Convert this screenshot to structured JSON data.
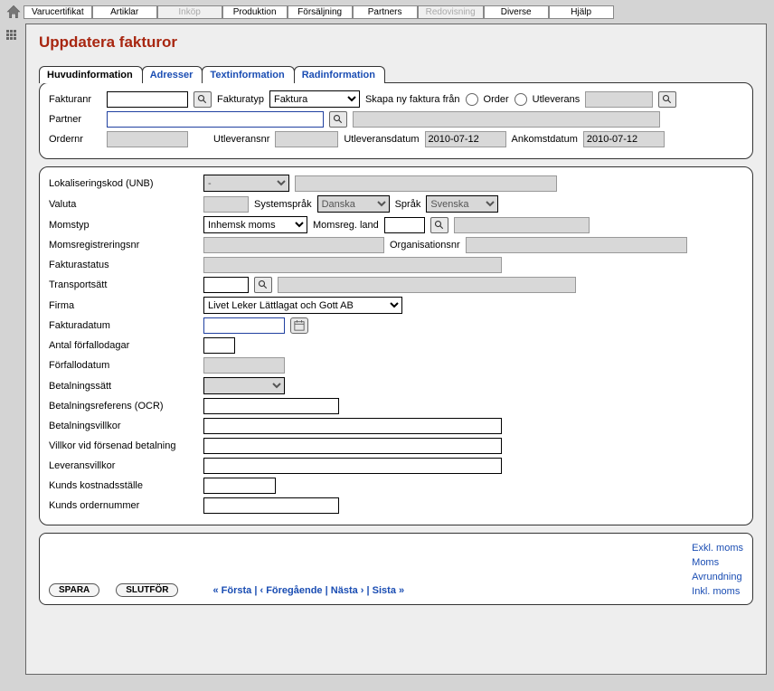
{
  "topTabs": [
    "Varucertifikat",
    "Artiklar",
    "Inköp",
    "Produktion",
    "Försäljning",
    "Partners",
    "Redovisning",
    "Diverse",
    "Hjälp"
  ],
  "topTabsDisabled": [
    2,
    6
  ],
  "pageTitle": "Uppdatera fakturor",
  "tabs": [
    "Huvudinformation",
    "Adresser",
    "Textinformation",
    "Radinformation"
  ],
  "activeTab": 0,
  "sec1": {
    "fakturanr": "Fakturanr",
    "fakturatyp": "Fakturatyp",
    "fakturatypVal": "Faktura",
    "skapa": "Skapa ny faktura från",
    "order": "Order",
    "utleverans": "Utleverans",
    "partner": "Partner",
    "ordernr": "Ordernr",
    "utleveransnr": "Utleveransnr",
    "utleveransdatum": "Utleveransdatum",
    "utleveransdatumVal": "2010-07-12",
    "ankomstdatum": "Ankomstdatum",
    "ankomstdatumVal": "2010-07-12"
  },
  "sec2": {
    "lokalisering": "Lokaliseringskod (UNB)",
    "lokaliseringVal": "-",
    "valuta": "Valuta",
    "systemsprak": "Systemspråk",
    "systemsprakVal": "Danska",
    "sprak": "Språk",
    "sprakVal": "Svenska",
    "momstyp": "Momstyp",
    "momstypVal": "Inhemsk moms",
    "momsregland": "Momsreg. land",
    "momsregnr": "Momsregistreringsnr",
    "organisationsnr": "Organisationsnr",
    "fakturastatus": "Fakturastatus",
    "transportsatt": "Transportsätt",
    "firma": "Firma",
    "firmaVal": "Livet Leker Lättlagat och Gott AB",
    "fakturadatum": "Fakturadatum",
    "forfallodagar": "Antal förfallodagar",
    "forfallodatum": "Förfallodatum",
    "betalningssatt": "Betalningssätt",
    "ocr": "Betalningsreferens (OCR)",
    "betalningsvillkor": "Betalningsvillkor",
    "forsenad": "Villkor vid försenad betalning",
    "leveransvillkor": "Leveransvillkor",
    "kostnadsstalle": "Kunds kostnadsställe",
    "ordernummer": "Kunds ordernummer"
  },
  "footer": {
    "spara": "SPARA",
    "slutfor": "SLUTFÖR",
    "forsta": "« Första",
    "foregaende": "‹ Föregående",
    "nasta": "Nästa ›",
    "sista": "Sista »",
    "sep": " | "
  },
  "totals": [
    "Exkl. moms",
    "Moms",
    "Avrundning",
    "Inkl. moms"
  ]
}
